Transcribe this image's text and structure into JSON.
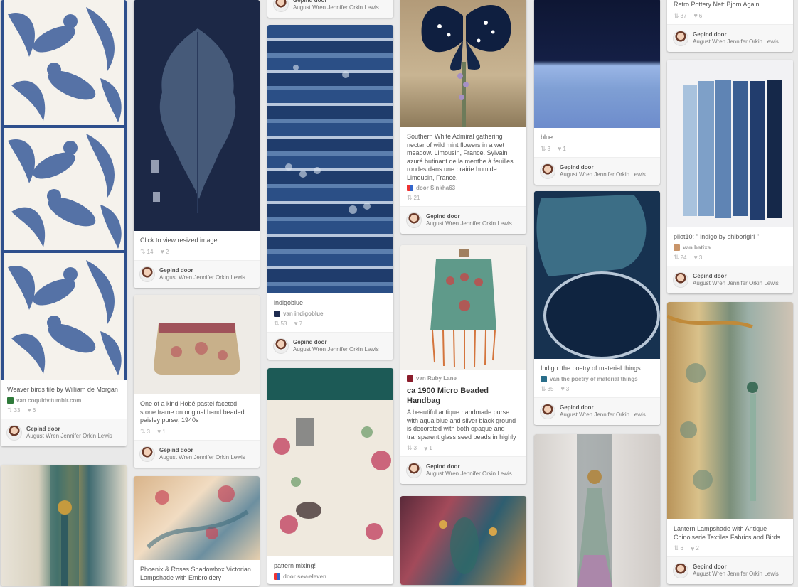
{
  "footer": {
    "board_owner": "Gepind door",
    "board": "August Wren Jennifer Orkin Lewis"
  },
  "pins": [
    {
      "id": "p1",
      "desc": "Weaver birds tile by William de Morgan",
      "source": "van coquidv.tumblr.com",
      "repins": "33",
      "likes": "6"
    },
    {
      "id": "p2",
      "desc": "Click to view resized image",
      "repins": "14",
      "likes": "2"
    },
    {
      "id": "p3",
      "desc": "One of a kind Hobé pastel faceted stone frame on original hand beaded paisley purse, 1940s",
      "repins": "3",
      "likes": "1"
    },
    {
      "id": "p4",
      "desc": "Phoenix & Roses Shadowbox Victorian Lampshade with Embroidery"
    },
    {
      "id": "p5",
      "desc": "indigoblue",
      "source": "van indigoblue",
      "repins": "53",
      "likes": "7"
    },
    {
      "id": "p6",
      "desc": "pattern mixing!",
      "source": "door sev-eleven"
    },
    {
      "id": "p7",
      "desc": "Southern White Admiral gathering nectar of wild mint flowers in a wet meadow. Limousin, France. Sylvain azuré butinant de la menthe à feuilles rondes dans une prairie humide. Limousin, France.",
      "source": "door Sinkha63",
      "repins": "21"
    },
    {
      "id": "p8",
      "desc": "ca 1900 Micro Beaded Handbag",
      "source": "van Ruby Lane",
      "extra": "A beautiful antique handmade purse with aqua blue and silver black ground is decorated with both opaque and transparent glass seed beads in highly",
      "repins": "3",
      "likes": "1"
    },
    {
      "id": "p9",
      "desc": "blue",
      "repins": "3",
      "likes": "1"
    },
    {
      "id": "p10",
      "desc": "Indigo :the poetry of material things",
      "source": "van the poetry of material things",
      "repins": "35",
      "likes": "3"
    },
    {
      "id": "p11",
      "desc": "Retro Pottery Net: Bjorn Again",
      "repins": "37",
      "likes": "6"
    },
    {
      "id": "p12",
      "desc": "pilot10: \" indigo by shiborigirl \"",
      "source": "van batixa",
      "repins": "24",
      "likes": "3"
    },
    {
      "id": "p13",
      "desc": "Lantern Lampshade with Antique Chinoiserie Textiles Fabrics and Birds",
      "repins": "6",
      "likes": "2"
    }
  ],
  "icons": {
    "repin": "repin-icon",
    "like": "heart-icon"
  },
  "colors": {
    "background": "#e9e9e9",
    "card": "#ffffff",
    "footer": "#f7f7f7",
    "indigo": "#1d2b4f"
  }
}
